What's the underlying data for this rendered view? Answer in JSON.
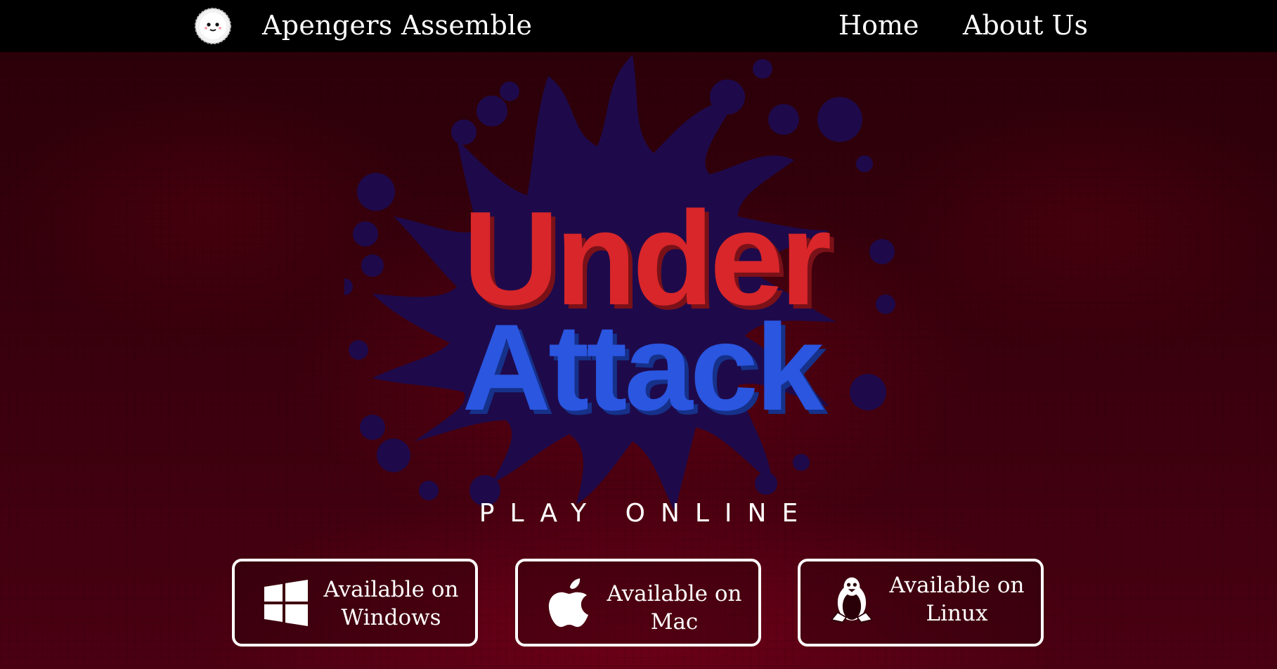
{
  "header": {
    "brand": "Apengers Assemble",
    "logo_icon": "fluffy-ball-face-icon",
    "nav": [
      {
        "label": "Home"
      },
      {
        "label": "About Us"
      }
    ]
  },
  "hero": {
    "logo_word_1": "Under",
    "logo_word_2": "Attack",
    "play_online": "PLAY ONLINE"
  },
  "downloads": [
    {
      "line1": "Available on",
      "line2": "Windows",
      "icon": "windows-icon"
    },
    {
      "line1": "Available on",
      "line2": "Mac",
      "icon": "apple-icon"
    },
    {
      "line1": "Available on",
      "line2": "Linux",
      "icon": "linux-tux-icon"
    }
  ],
  "colors": {
    "header_bg": "#000000",
    "page_bg": "#3a000d",
    "splat": "#1e0a4a",
    "title_red": "#d8262a",
    "title_blue": "#2a56e0",
    "text": "#ffffff"
  }
}
